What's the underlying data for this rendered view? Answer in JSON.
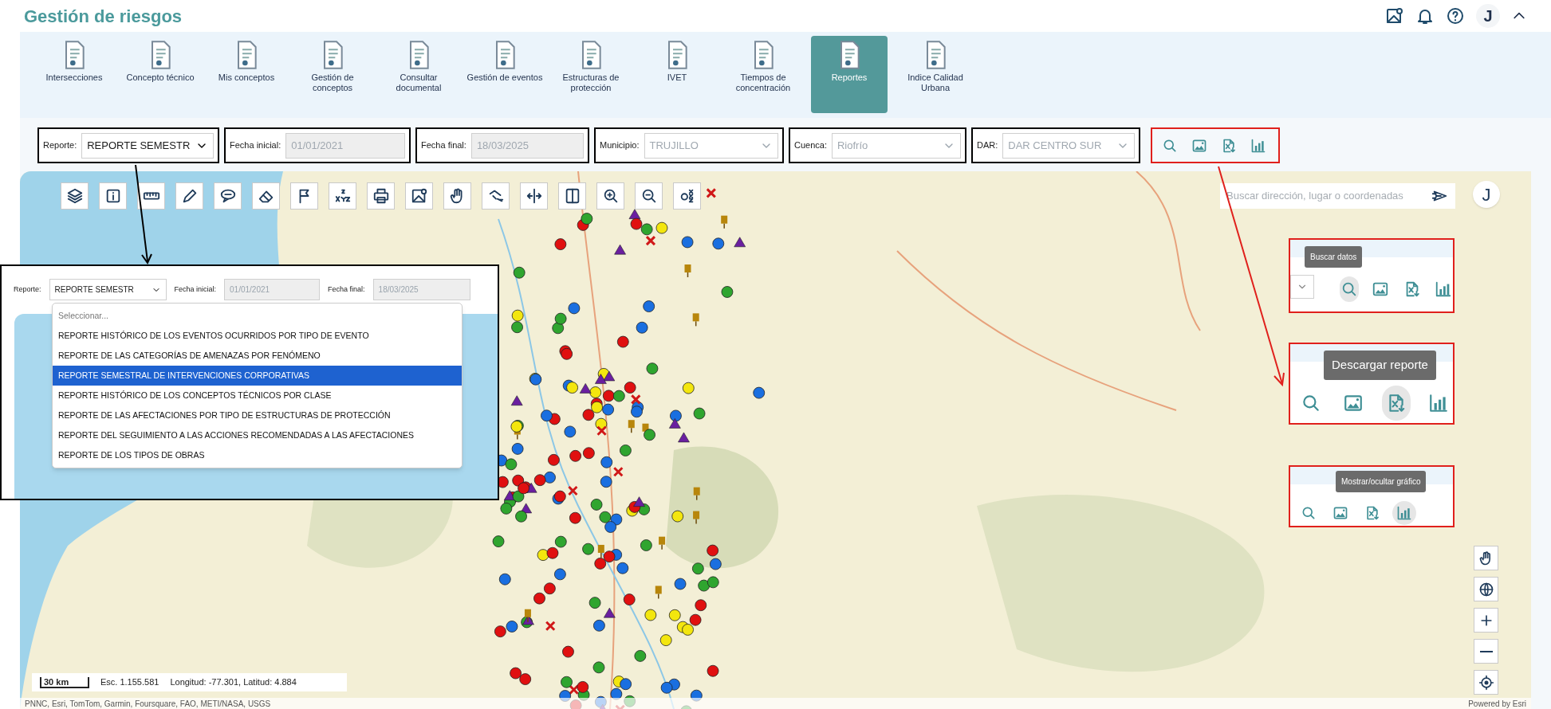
{
  "app": {
    "title": "Gestión de riesgos",
    "user_initial": "J"
  },
  "modules": [
    {
      "label": "Intersecciones",
      "selected": false
    },
    {
      "label": "Concepto técnico",
      "selected": false
    },
    {
      "label": "Mis conceptos",
      "selected": false
    },
    {
      "label": "Gestión de conceptos",
      "selected": false
    },
    {
      "label": "Consultar documental",
      "selected": false
    },
    {
      "label": "Gestión de eventos",
      "selected": false
    },
    {
      "label": "Estructuras de protección",
      "selected": false
    },
    {
      "label": "IVET",
      "selected": false
    },
    {
      "label": "Tiempos de concentración",
      "selected": false
    },
    {
      "label": "Reportes",
      "selected": true
    },
    {
      "label": "Indice Calidad Urbana",
      "selected": false
    }
  ],
  "filters": [
    {
      "kind": "select",
      "label": "Reporte:",
      "value": "REPORTE SEMESTR",
      "disabled": false
    },
    {
      "kind": "date",
      "label": "Fecha inicial:",
      "value": "01/01/2021",
      "disabled": true
    },
    {
      "kind": "date",
      "label": "Fecha final:",
      "value": "18/03/2025",
      "disabled": true
    },
    {
      "kind": "select",
      "label": "Municipio:",
      "value": "TRUJILLO",
      "disabled": true
    },
    {
      "kind": "select",
      "label": "Cuenca:",
      "value": "Riofrío",
      "disabled": true
    },
    {
      "kind": "select",
      "label": "DAR:",
      "value": "DAR CENTRO SUR",
      "disabled": true
    }
  ],
  "map": {
    "search_placeholder": "Buscar dirección, lugar o coordenadas",
    "user_initial": "J",
    "scale": "30 km",
    "scale_ratio": "Esc. 1.155.581",
    "coordinates": "Longitud: -77.301, Latitud: 4.884",
    "attribution": "PNNC, Esri, TomTom, Garmin, Foursquare, FAO, METI/NASA, USGS",
    "powered_by": "Powered by Esri"
  },
  "inset": {
    "filters": [
      {
        "label": "Reporte:",
        "value": "REPORTE SEMESTR"
      },
      {
        "label": "Fecha inicial:",
        "value": "01/01/2021"
      },
      {
        "label": "Fecha final:",
        "value": "18/03/2025"
      }
    ],
    "options": [
      {
        "kind": "placeholder",
        "label": "Seleccionar...",
        "selected": false
      },
      {
        "kind": "option",
        "label": "REPORTE HISTÓRICO DE LOS EVENTOS OCURRIDOS POR TIPO DE EVENTO",
        "selected": false
      },
      {
        "kind": "option",
        "label": "REPORTE DE LAS CATEGORÍAS DE AMENAZAS POR FENÓMENO",
        "selected": false
      },
      {
        "kind": "option",
        "label": "REPORTE SEMESTRAL DE INTERVENCIONES CORPORATIVAS",
        "selected": true
      },
      {
        "kind": "option",
        "label": "REPORTE HISTÓRICO DE LOS CONCEPTOS TÉCNICOS POR CLASE",
        "selected": false
      },
      {
        "kind": "option",
        "label": "REPORTE DE LAS AFECTACIONES POR TIPO DE ESTRUCTURAS DE PROTECCIÓN",
        "selected": false
      },
      {
        "kind": "option",
        "label": "REPORTE DEL SEGUIMIENTO A LAS ACCIONES RECOMENDADAS A LAS AFECTACIONES",
        "selected": false
      },
      {
        "kind": "option",
        "label": "REPORTE DE LOS TIPOS DE OBRAS",
        "selected": false
      }
    ]
  },
  "callouts": [
    {
      "tooltip": "Buscar datos",
      "actions": [
        {
          "selected": true
        },
        {
          "selected": false
        },
        {
          "selected": false
        },
        {
          "selected": false
        }
      ]
    },
    {
      "tooltip": "Descargar reporte",
      "actions": [
        {
          "selected": false
        },
        {
          "selected": false
        },
        {
          "selected": true
        },
        {
          "selected": false
        }
      ]
    },
    {
      "tooltip": "Mostrar/ocultar gráfico",
      "actions": [
        {
          "selected": false
        },
        {
          "selected": false
        },
        {
          "selected": false
        },
        {
          "selected": true
        }
      ]
    }
  ]
}
